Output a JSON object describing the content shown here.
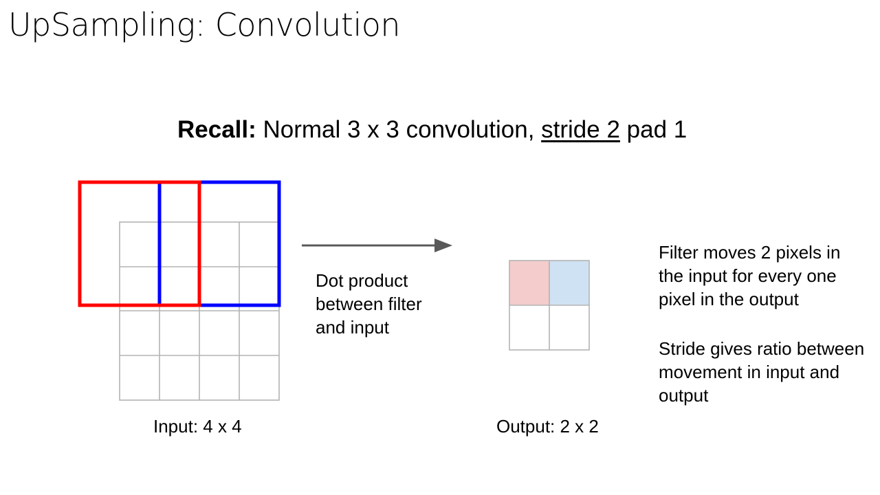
{
  "slide": {
    "title": "UpSampling: Convolution"
  },
  "recall": {
    "prefix": "Recall:",
    "middle": " Normal 3 x 3 convolution, ",
    "underlined": "stride 2",
    "suffix": " pad 1"
  },
  "arrow_text": {
    "lines": [
      "Dot product",
      "between filter",
      "and input"
    ]
  },
  "description": {
    "paragraph1": [
      "Filter moves 2 pixels in",
      "the input for every one",
      "pixel in the output"
    ],
    "paragraph2": [
      "Stride gives ratio between",
      "movement in input and",
      "output"
    ]
  },
  "input_grid": {
    "caption": "Input: 4 x 4",
    "rows": 4,
    "cols": 4
  },
  "output_grid": {
    "caption": "Output: 2 x 2",
    "rows": 2,
    "cols": 2
  },
  "colors": {
    "grid_line": "#b3b3b3",
    "filter_first": "#ff0000",
    "filter_second": "#0000ff",
    "output_first_fill": "#f4cccc",
    "output_second_fill": "#cfe2f3",
    "arrow": "#595959"
  }
}
